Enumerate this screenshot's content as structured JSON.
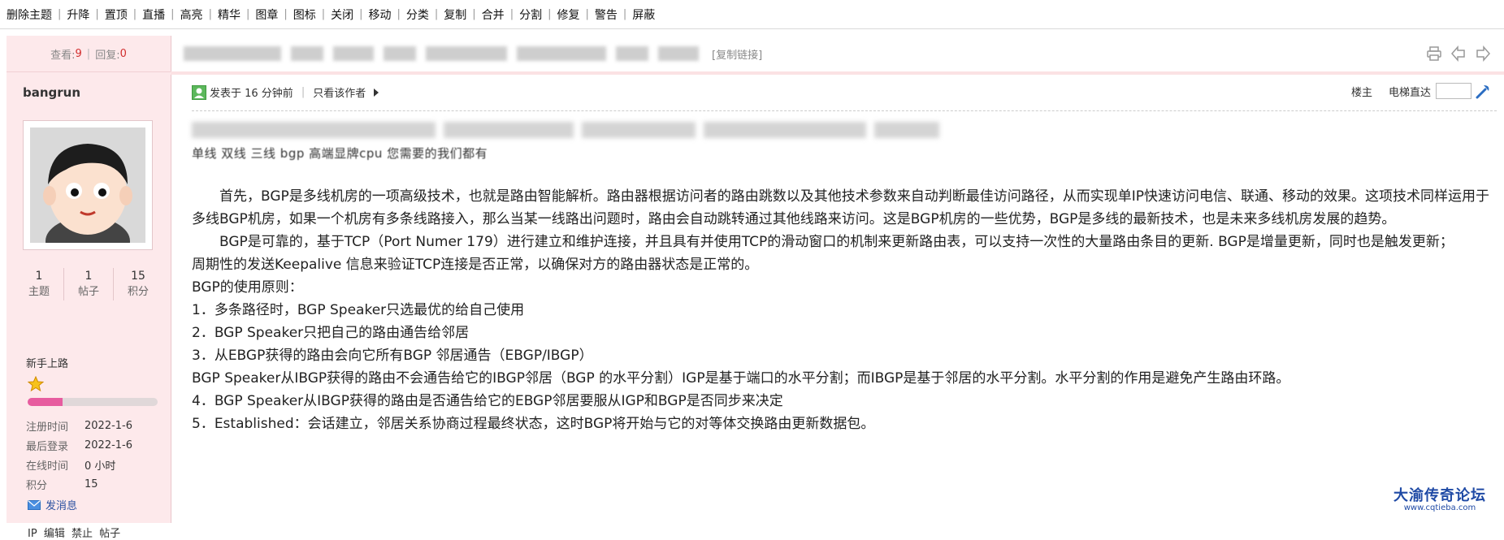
{
  "toolbar": {
    "items": [
      "删除主题",
      "升降",
      "置顶",
      "直播",
      "高亮",
      "精华",
      "图章",
      "图标",
      "关闭",
      "移动",
      "分类",
      "复制",
      "合并",
      "分割",
      "修复",
      "警告",
      "屏蔽"
    ]
  },
  "stats": {
    "views_label": "查看:",
    "views": "9",
    "replies_label": "回复:",
    "replies": "0"
  },
  "author": {
    "name": "bangrun",
    "counts": [
      {
        "value": "1",
        "label": "主题"
      },
      {
        "value": "1",
        "label": "帖子"
      },
      {
        "value": "15",
        "label": "积分"
      }
    ],
    "group": "新手上路",
    "level_progress": 0.27,
    "info": [
      {
        "key": "注册时间",
        "value": "2022-1-6"
      },
      {
        "key": "最后登录",
        "value": "2022-1-6"
      },
      {
        "key": "在线时间",
        "value": "0 小时"
      },
      {
        "key": "积分",
        "value": "15"
      }
    ],
    "send_message": "发消息",
    "admin_links": [
      "IP",
      "编辑",
      "禁止",
      "帖子"
    ]
  },
  "thread": {
    "copy_link": "[复制链接]"
  },
  "post": {
    "posted_at": "发表于 16 分钟前",
    "only_author": "只看该作者",
    "floor_label": "楼主",
    "jump_label": "电梯直达",
    "subline": "单线 双线 三线 bgp 高端显牌cpu 您需要的我们都有",
    "paragraphs": [
      {
        "indent": true,
        "text": "首先，BGP是多线机房的一项高级技术，也就是路由智能解析。路由器根据访问者的路由跳数以及其他技术参数来自动判断最佳访问路径，从而实现单IP快速访问电信、联通、移动的效果。这项技术同样运用于多线BGP机房，如果一个机房有多条线路接入，那么当某一线路出问题时，路由会自动跳转通过其他线路来访问。这是BGP机房的一些优势，BGP是多线的最新技术，也是未来多线机房发展的趋势。"
      },
      {
        "indent": true,
        "text": "BGP是可靠的，基于TCP（Port Numer 179）进行建立和维护连接，并且具有并使用TCP的滑动窗口的机制来更新路由表，可以支持一次性的大量路由条目的更新. BGP是增量更新，同时也是触发更新；"
      },
      {
        "indent": false,
        "text": "周期性的发送Keepalive 信息来验证TCP连接是否正常，以确保对方的路由器状态是正常的。"
      },
      {
        "indent": false,
        "text": "BGP的使用原则："
      },
      {
        "indent": false,
        "text": "1．多条路径时，BGP Speaker只选最优的给自己使用"
      },
      {
        "indent": false,
        "text": "2．BGP Speaker只把自己的路由通告给邻居"
      },
      {
        "indent": false,
        "text": "3．从EBGP获得的路由会向它所有BGP 邻居通告（EBGP/IBGP）"
      },
      {
        "indent": false,
        "text": "BGP Speaker从IBGP获得的路由不会通告给它的IBGP邻居（BGP 的水平分割）IGP是基于端口的水平分割；而IBGP是基于邻居的水平分割。水平分割的作用是避免产生路由环路。"
      },
      {
        "indent": false,
        "text": "4．BGP Speaker从IBGP获得的路由是否通告给它的EBGP邻居要服从IGP和BGP是否同步来决定"
      },
      {
        "indent": false,
        "text": "5．Established：会话建立，邻居关系协商过程最终状态，这时BGP将开始与它的对等体交换路由更新数据包。"
      }
    ]
  },
  "watermark": {
    "brand": "大渝传奇论坛",
    "url": "www.cqtieba.com"
  },
  "colors": {
    "sidebar_bg": "#fde9eb",
    "accent_red": "#d12d2d",
    "link_blue": "#2b51a1",
    "progress": "#e75c9f"
  }
}
